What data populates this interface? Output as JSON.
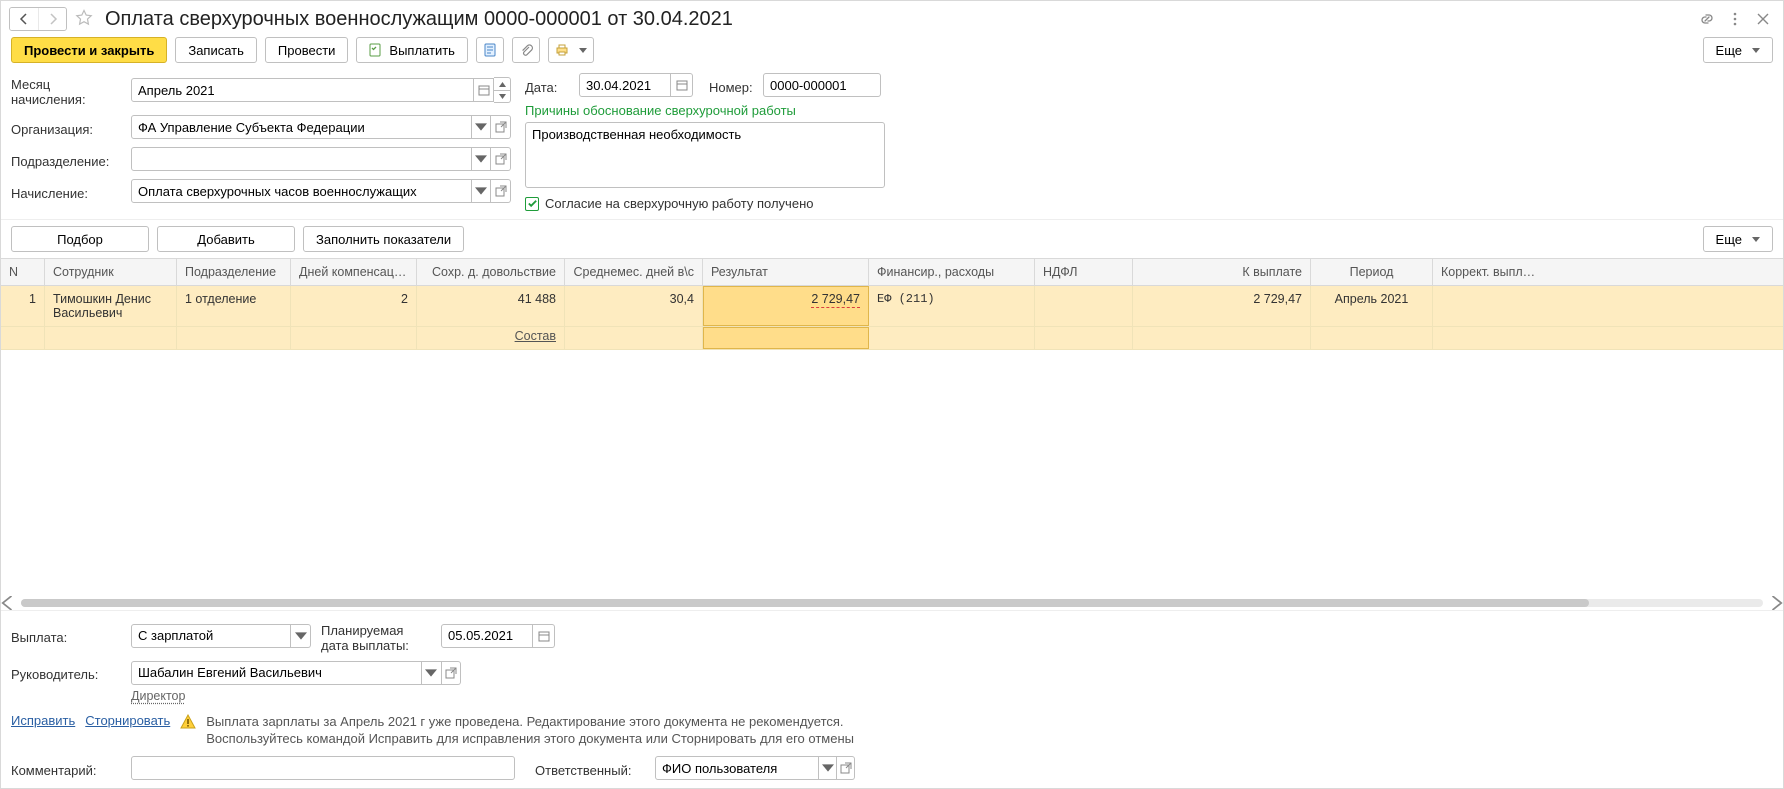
{
  "header": {
    "title": "Оплата сверхурочных военнослужащим 0000-000001 от 30.04.2021"
  },
  "toolbar": {
    "post_close": "Провести и закрыть",
    "save": "Записать",
    "post": "Провести",
    "pay": "Выплатить",
    "more": "Еще"
  },
  "form": {
    "month_label": "Месяц начисления:",
    "month_value": "Апрель 2021",
    "org_label": "Организация:",
    "org_value": "ФА Управление Субъекта Федерации",
    "dept_label": "Подразделение:",
    "dept_value": "",
    "calc_label": "Начисление:",
    "calc_value": "Оплата сверхурочных часов военнослужащих",
    "date_label": "Дата:",
    "date_value": "30.04.2021",
    "num_label": "Номер:",
    "num_value": "0000-000001",
    "reason_label": "Причины обоснование сверхурочной работы",
    "reason_value": "Производственная необходимость",
    "consent_label": "Согласие на сверхурочную работу получено",
    "consent_checked": true
  },
  "mid": {
    "pick": "Подбор",
    "add": "Добавить",
    "fill": "Заполнить показатели",
    "more": "Еще"
  },
  "table": {
    "headers": {
      "n": "N",
      "emp": "Сотрудник",
      "dept": "Подразделение",
      "comp_days": "Дней компенсации в\\с",
      "sokhr": "Сохр. д. довольствие",
      "avg_days": "Среднемес. дней в\\с",
      "result": "Результат",
      "fin": "Финансир., расходы",
      "ndfl": "НДФЛ",
      "to_pay": "К выплате",
      "period": "Период",
      "corr": "Коррект. выплаты"
    },
    "rows": [
      {
        "n": "1",
        "emp": "Тимошкин Денис Васильевич",
        "dept": "1 отделение",
        "comp_days": "2",
        "sokhr": "41 488",
        "avg_days": "30,4",
        "result": "2 729,47",
        "fin": "ЕФ (211)",
        "ndfl": "",
        "to_pay": "2 729,47",
        "period": "Апрель 2021",
        "corr": ""
      }
    ],
    "sostav": "Состав"
  },
  "footer": {
    "payout_label": "Выплата:",
    "payout_value": "С зарплатой",
    "planned_label": "Планируемая дата выплаты:",
    "planned_value": "05.05.2021",
    "manager_label": "Руководитель:",
    "manager_value": "Шабалин Евгений Васильевич",
    "manager_pos": "Директор",
    "fix_link": "Исправить",
    "storno_link": "Сторнировать",
    "warn_line1": "Выплата зарплаты за Апрель 2021 г уже проведена. Редактирование этого документа не рекомендуется.",
    "warn_line2": "Воспользуйтесь командой Исправить для исправления этого документа или Сторнировать для его отмены",
    "comment_label": "Комментарий:",
    "comment_value": "",
    "resp_label": "Ответственный:",
    "resp_value": "ФИО пользователя"
  }
}
